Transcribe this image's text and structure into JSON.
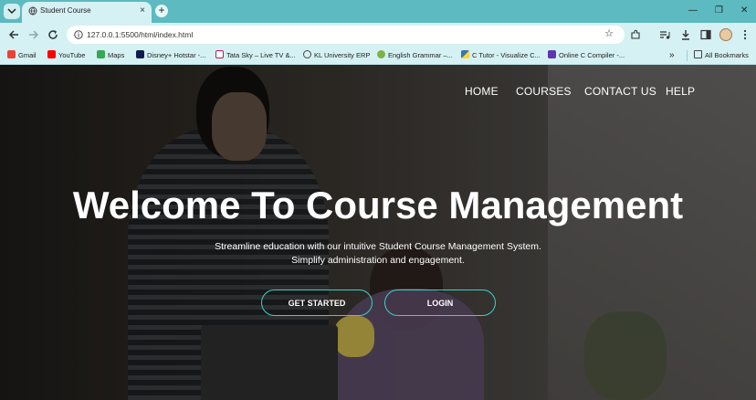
{
  "browser": {
    "tab_title": "Student Course",
    "new_tab_symbol": "+",
    "close_symbol": "×",
    "url": "127.0.0.1:5500/html/index.html",
    "window_controls": [
      "—",
      "❐",
      "✕"
    ]
  },
  "bookmarks": [
    {
      "label": "Gmail",
      "color": "#ea4335"
    },
    {
      "label": "YouTube",
      "color": "#ff0000"
    },
    {
      "label": "Maps",
      "color": "#34a853"
    },
    {
      "label": "Disney+ Hotstar -...",
      "color": "#0f1b4d"
    },
    {
      "label": "Tata Sky – Live TV &...",
      "color": "#c2185b"
    },
    {
      "label": "KL University ERP",
      "color": "#ffffff"
    },
    {
      "label": "English Grammar –...",
      "color": "#7cb342"
    },
    {
      "label": "C Tutor - Visualize C...",
      "color": "#3776ab"
    },
    {
      "label": "Online C Compiler -...",
      "color": "#5e35b1"
    }
  ],
  "bookmarks_overflow": "»",
  "all_bookmarks": "All Bookmarks",
  "nav": {
    "home": "HOME",
    "courses": "COURSES",
    "contact": "CONTACT US",
    "help": "HELP"
  },
  "hero": {
    "title": "Welcome To Course Management",
    "subtitle_line1": "Streamline education with our intuitive Student Course Management System.",
    "subtitle_line2": "Simplify administration and engagement.",
    "get_started": "GET STARTED",
    "login": "LOGIN"
  },
  "colors": {
    "accent": "#3ad0c8",
    "browser_frame": "#5cbac0",
    "toolbar": "#d5f1f3"
  }
}
